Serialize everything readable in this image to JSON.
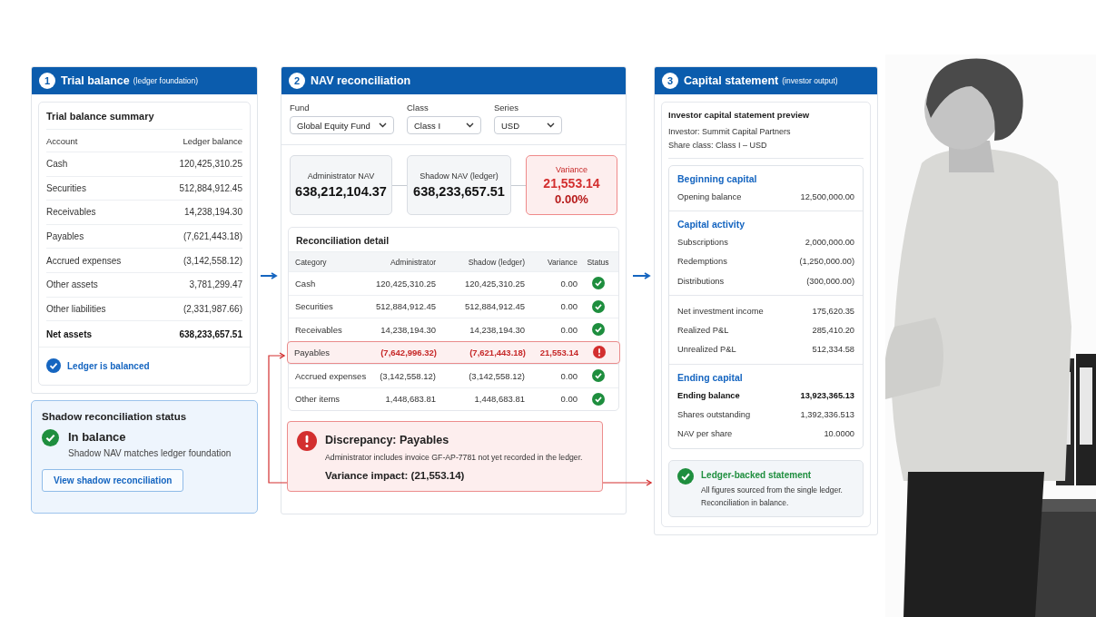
{
  "trial_balance": {
    "step": "1",
    "title": "Trial balance",
    "subtitle": "(ledger foundation)",
    "card_title": "Trial balance summary",
    "columns": [
      "Account",
      "Ledger balance"
    ],
    "rows": [
      {
        "account": "Cash",
        "balance": "120,425,310.25",
        "bold": false
      },
      {
        "account": "Securities",
        "balance": "512,884,912.45",
        "bold": false
      },
      {
        "account": "Receivables",
        "balance": "14,238,194.30",
        "bold": false
      },
      {
        "account": "Payables",
        "balance": "(7,621,443.18)",
        "bold": false
      },
      {
        "account": "Accrued expenses",
        "balance": "(3,142,558.12)",
        "bold": false
      },
      {
        "account": "Other assets",
        "balance": "3,781,299.47",
        "bold": false
      },
      {
        "account": "Other liabilities",
        "balance": "(2,331,987.66)",
        "bold": false
      },
      {
        "account": "Net assets",
        "balance": "638,233,657.51",
        "bold": true
      }
    ],
    "status": "Ledger is balanced"
  },
  "shadow_status": {
    "title": "Shadow reconciliation status",
    "state": "In balance",
    "note": "Shadow NAV matches ledger foundation",
    "button": "View shadow reconciliation"
  },
  "nav_reconciliation": {
    "step": "2",
    "title": "NAV reconciliation",
    "filters": [
      {
        "label": "Fund",
        "value": "Global Equity Fund"
      },
      {
        "label": "Class",
        "value": "Class I"
      },
      {
        "label": "Series",
        "value": "USD"
      }
    ],
    "metrics": [
      {
        "kind": "nav",
        "label": "Administrator NAV",
        "value": "638,212,104.37"
      },
      {
        "kind": "nav",
        "label": "Shadow NAV (ledger)",
        "value": "638,233,657.51"
      },
      {
        "kind": "variance",
        "label": "Variance",
        "value": "21,553.14",
        "percent": "0.00%"
      }
    ],
    "detail": {
      "title": "Reconciliation detail",
      "columns": [
        "Category",
        "Administrator",
        "Shadow (ledger)",
        "Variance",
        "Status"
      ],
      "rows": [
        {
          "category": "Cash",
          "administrator": "120,425,310.25",
          "shadow": "120,425,310.25",
          "variance": "0.00",
          "kind": "ok"
        },
        {
          "category": "Securities",
          "administrator": "512,884,912.45",
          "shadow": "512,884,912.45",
          "variance": "0.00",
          "kind": "ok"
        },
        {
          "category": "Receivables",
          "administrator": "14,238,194.30",
          "shadow": "14,238,194.30",
          "variance": "0.00",
          "kind": "ok"
        },
        {
          "category": "Payables",
          "administrator": "(7,642,996.32)",
          "shadow": "(7,621,443.18)",
          "variance": "21,553.14",
          "kind": "mismatch"
        },
        {
          "category": "Accrued expenses",
          "administrator": "(3,142,558.12)",
          "shadow": "(3,142,558.12)",
          "variance": "0.00",
          "kind": "ok"
        },
        {
          "category": "Other items",
          "administrator": "1,448,683.81",
          "shadow": "1,448,683.81",
          "variance": "0.00",
          "kind": "ok"
        }
      ]
    },
    "alert": {
      "title": "Discrepancy: Payables",
      "message": "Administrator includes invoice GF-AP-7781 not yet recorded in the ledger.",
      "impact": "Variance impact: (21,553.14)"
    }
  },
  "capital_statement": {
    "step": "3",
    "title": "Capital statement",
    "subtitle": "(investor output)",
    "card_title": "Investor capital statement preview",
    "investor": "Investor: Summit Capital Partners",
    "share_class": "Share class: Class I – USD",
    "sections": [
      {
        "heading": "Beginning capital",
        "rows": [
          {
            "label": "Opening balance",
            "value": "12,500,000.00",
            "bold": false
          }
        ]
      },
      {
        "heading": "Capital activity",
        "rows": [
          {
            "label": "Subscriptions",
            "value": "2,000,000.00",
            "bold": false
          },
          {
            "label": "Redemptions",
            "value": "(1,250,000.00)",
            "bold": false
          },
          {
            "label": "Distributions",
            "value": "(300,000.00)",
            "bold": false
          }
        ]
      },
      {
        "rows": [
          {
            "label": "Net investment income",
            "value": "175,620.35",
            "bold": false
          },
          {
            "label": "Realized P&L",
            "value": "285,410.20",
            "bold": false
          },
          {
            "label": "Unrealized P&L",
            "value": "512,334.58",
            "bold": false
          }
        ]
      },
      {
        "heading": "Ending capital",
        "rows": [
          {
            "label": "Ending balance",
            "value": "13,923,365.13",
            "bold": true
          },
          {
            "label": "Shares outstanding",
            "value": "1,392,336.513",
            "bold": false
          },
          {
            "label": "NAV per share",
            "value": "10.0000",
            "bold": false
          }
        ]
      }
    ],
    "footer": {
      "title": "Ledger-backed statement",
      "lines": [
        "All figures sourced from the single ledger.",
        "Reconciliation in balance."
      ]
    }
  }
}
